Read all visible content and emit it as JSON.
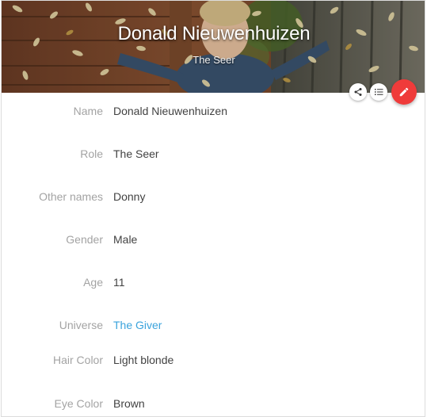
{
  "header": {
    "title": "Donald Nieuwenhuizen",
    "subtitle": "The Seer"
  },
  "actions": {
    "share_icon": "share-icon",
    "list_icon": "list-icon",
    "edit_icon": "pencil-icon",
    "edit_color": "#ef3b3a"
  },
  "fields": [
    {
      "label": "Name",
      "value": "Donald Nieuwenhuizen"
    },
    {
      "label": "Role",
      "value": "The Seer"
    },
    {
      "label": "Other names",
      "value": "Donny"
    },
    {
      "label": "Gender",
      "value": "Male"
    },
    {
      "label": "Age",
      "value": "11"
    },
    {
      "label": "Universe",
      "value": "The Giver"
    },
    {
      "label": "Hair Color",
      "value": "Light blonde"
    },
    {
      "label": "Eye Color",
      "value": "Brown"
    }
  ],
  "colors": {
    "label": "#a3a3a3",
    "value": "#424242",
    "link": "#3aa3dc"
  }
}
